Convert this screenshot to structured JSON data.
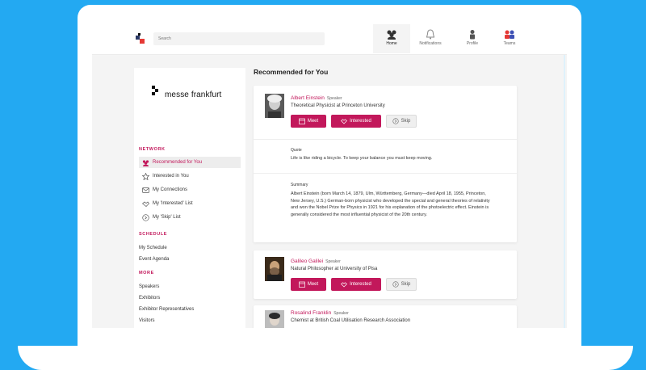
{
  "topbar": {
    "search_placeholder": "Search",
    "nav": [
      {
        "label": "Home",
        "icon": "home-icon"
      },
      {
        "label": "Notifications",
        "icon": "bell-icon"
      },
      {
        "label": "Profile",
        "icon": "profile-icon"
      },
      {
        "label": "Teams",
        "icon": "teams-icon"
      }
    ]
  },
  "sidebar": {
    "brand": "messe frankfurt",
    "network_title": "NETWORK",
    "network_items": [
      {
        "label": "Recommended for You",
        "icon": "people-icon",
        "active": true
      },
      {
        "label": "Interested in You",
        "icon": "star-icon"
      },
      {
        "label": "My Connections",
        "icon": "connections-icon"
      },
      {
        "label": "My 'Interested' List",
        "icon": "handshake-icon"
      },
      {
        "label": "My 'Skip' List",
        "icon": "skip-icon"
      }
    ],
    "schedule_title": "SCHEDULE",
    "schedule_items": [
      "My Schedule",
      "Event Agenda"
    ],
    "more_title": "MORE",
    "more_items": [
      "Speakers",
      "Exhibitors",
      "Exhibitor Representatives",
      "Visitors"
    ]
  },
  "main": {
    "title": "Recommended for You",
    "buttons": {
      "meet": "Meet",
      "interested": "Interested",
      "skip": "Skip"
    },
    "people": [
      {
        "name": "Albert Einstein",
        "role": "Speaker",
        "title": "Theoretical Physicist at Princeton University",
        "quote_label": "Quote",
        "quote": "Life is like riding a bicycle. To keep your balance you must keep moving.",
        "summary_label": "Summary",
        "summary": "Albert Einstein (born March 14, 1879, Ulm, Württemberg, Germany—died April 18, 1955, Princeton, New Jersey, U.S.) German-born physicist who developed the special and general theories of relativity and won the Nobel Prize for Physics in 1921 for his explanation of the photoelectric effect. Einstein is generally considered the most influential physicist of the 20th century."
      },
      {
        "name": "Galileo Galilei",
        "role": "Speaker",
        "title": "Natural Philosopher at University of Pisa"
      },
      {
        "name": "Rosalind Franklin",
        "role": "Speaker",
        "title": "Chemist at British Coal Utilisation Research Association"
      }
    ]
  },
  "colors": {
    "accent": "#c2185b",
    "background": "#23a9f2"
  }
}
